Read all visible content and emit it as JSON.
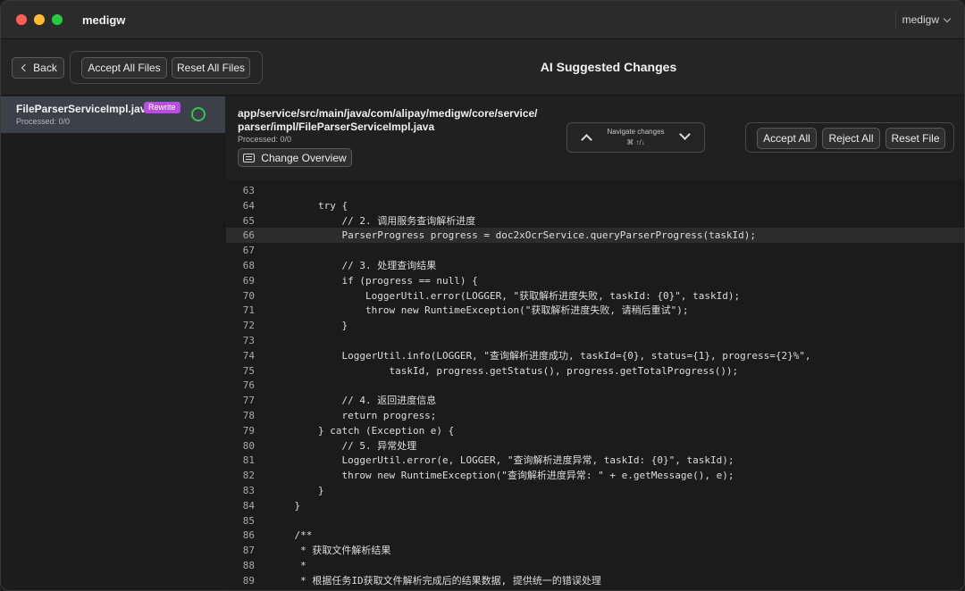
{
  "app": {
    "title": "medigw",
    "workspace": "medigw"
  },
  "toolbar": {
    "back_label": "Back",
    "accept_all_files_label": "Accept All Files",
    "reset_all_files_label": "Reset All Files",
    "title": "AI Suggested Changes"
  },
  "sidebar": {
    "files": [
      {
        "name": "FileParserServiceImpl.java",
        "badge": "Rewrite",
        "processed": "Processed: 0/0"
      }
    ]
  },
  "file_header": {
    "path_line1": "app/service/src/main/java/com/alipay/medigw/core/service/",
    "path_line2": "parser/impl/FileParserServiceImpl.java",
    "processed": "Processed: 0/0",
    "overview_label": "Change Overview",
    "navigate_label": "Navigate changes",
    "navigate_shortcut": "⌘ ↑/↓",
    "accept_all_label": "Accept All",
    "reject_all_label": "Reject All",
    "reset_file_label": "Reset File"
  },
  "code": {
    "highlighted_line": "66",
    "lines": [
      {
        "no": "63",
        "text": ""
      },
      {
        "no": "64",
        "text": "        try {"
      },
      {
        "no": "65",
        "text": "            // 2. 调用服务查询解析进度"
      },
      {
        "no": "66",
        "text": "            ParserProgress progress = doc2xOcrService.queryParserProgress(taskId);"
      },
      {
        "no": "67",
        "text": ""
      },
      {
        "no": "68",
        "text": "            // 3. 处理查询结果"
      },
      {
        "no": "69",
        "text": "            if (progress == null) {"
      },
      {
        "no": "70",
        "text": "                LoggerUtil.error(LOGGER, \"获取解析进度失败, taskId: {0}\", taskId);"
      },
      {
        "no": "71",
        "text": "                throw new RuntimeException(\"获取解析进度失败, 请稍后重试\");"
      },
      {
        "no": "72",
        "text": "            }"
      },
      {
        "no": "73",
        "text": ""
      },
      {
        "no": "74",
        "text": "            LoggerUtil.info(LOGGER, \"查询解析进度成功, taskId={0}, status={1}, progress={2}%\","
      },
      {
        "no": "75",
        "text": "                    taskId, progress.getStatus(), progress.getTotalProgress());"
      },
      {
        "no": "76",
        "text": ""
      },
      {
        "no": "77",
        "text": "            // 4. 返回进度信息"
      },
      {
        "no": "78",
        "text": "            return progress;"
      },
      {
        "no": "79",
        "text": "        } catch (Exception e) {"
      },
      {
        "no": "80",
        "text": "            // 5. 异常处理"
      },
      {
        "no": "81",
        "text": "            LoggerUtil.error(e, LOGGER, \"查询解析进度异常, taskId: {0}\", taskId);"
      },
      {
        "no": "82",
        "text": "            throw new RuntimeException(\"查询解析进度异常: \" + e.getMessage(), e);"
      },
      {
        "no": "83",
        "text": "        }"
      },
      {
        "no": "84",
        "text": "    }"
      },
      {
        "no": "85",
        "text": ""
      },
      {
        "no": "86",
        "text": "    /**"
      },
      {
        "no": "87",
        "text": "     * 获取文件解析结果"
      },
      {
        "no": "88",
        "text": "     *"
      },
      {
        "no": "89",
        "text": "     * 根据任务ID获取文件解析完成后的结果数据, 提供统一的错误处理"
      }
    ]
  }
}
